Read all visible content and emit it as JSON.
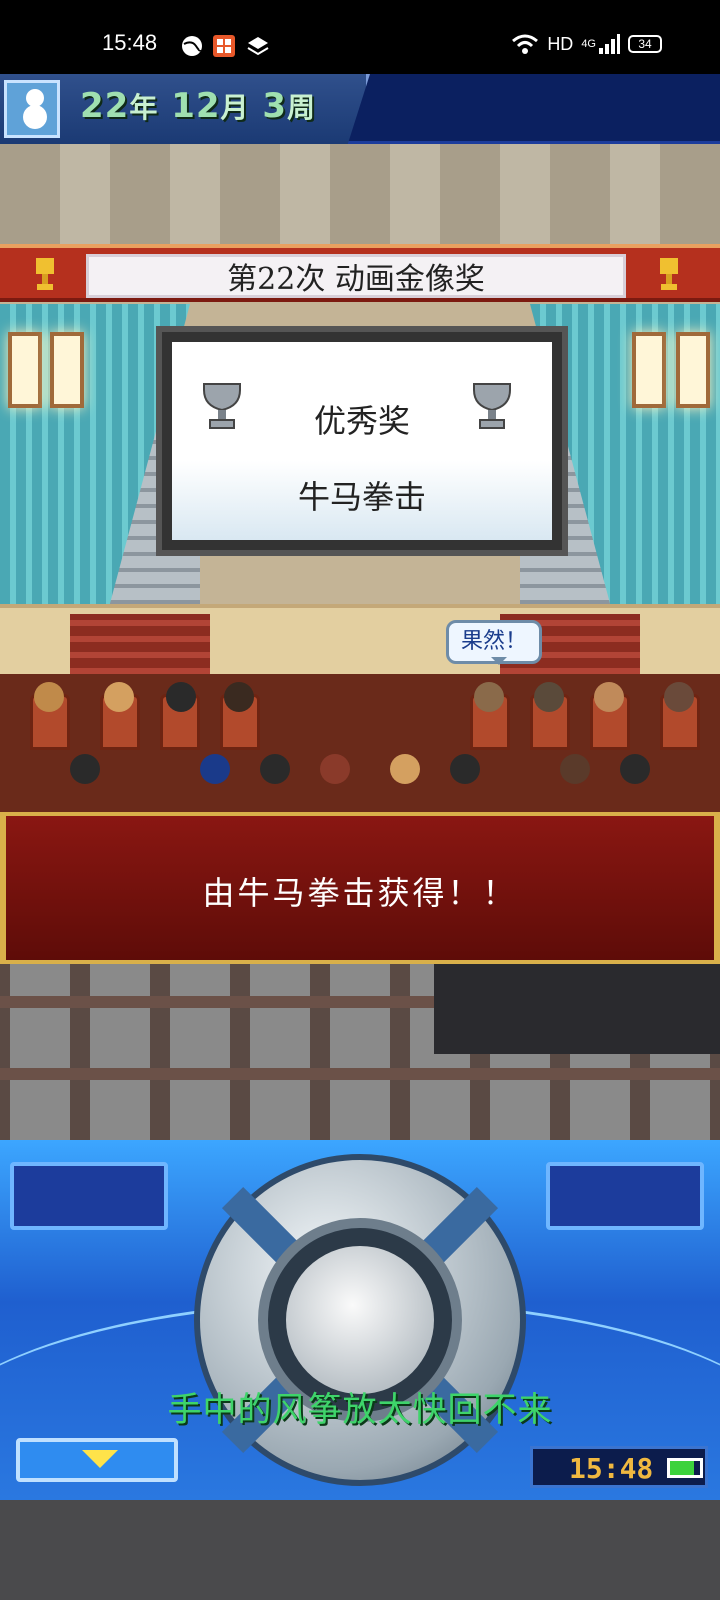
{
  "status_bar": {
    "time": "15:48",
    "network_label": "HD",
    "signal_label": "4G",
    "battery_level": "34",
    "icons": [
      "globe-icon",
      "app-icon",
      "layers-icon",
      "wifi-icon",
      "signal-icon",
      "battery-icon"
    ]
  },
  "game": {
    "date": {
      "year": "22",
      "year_unit": "年",
      "month": "12",
      "month_unit": "月",
      "week": "3",
      "week_unit": "周"
    },
    "event_banner": "第22次 动画金像奖",
    "award": {
      "title": "优秀奖",
      "work": "牛马拳击"
    },
    "speech_bubble": "果然！",
    "message": "由牛马拳击获得！！",
    "lyric": "手中的风筝放太快回不来",
    "clock": "15:48"
  },
  "colors": {
    "panel_blue": "#2a78e0",
    "message_red": "#8a1712",
    "gold_border": "#d9b04a",
    "lyric_green": "#3ed46a"
  }
}
